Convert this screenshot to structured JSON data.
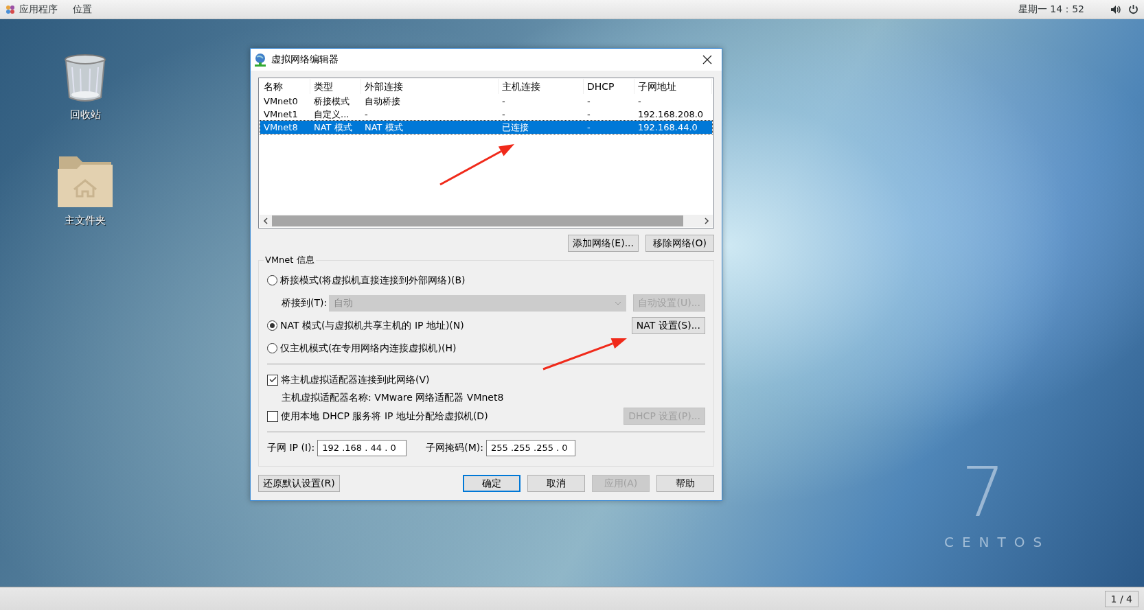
{
  "top_bar": {
    "menus": [
      "应用程序",
      "位置"
    ],
    "clock": "星期一 14：52"
  },
  "desktop_icons": [
    {
      "kind": "trash",
      "label": "回收站"
    },
    {
      "kind": "home",
      "label": "主文件夹"
    }
  ],
  "wallpaper": {
    "logo_number": "7",
    "logo_text": "CENTOS"
  },
  "dialog": {
    "title": "虚拟网络编辑器",
    "table": {
      "columns": [
        "名称",
        "类型",
        "外部连接",
        "主机连接",
        "DHCP",
        "子网地址"
      ],
      "rows": [
        {
          "cells": [
            "VMnet0",
            "桥接模式",
            "自动桥接",
            "-",
            "-",
            "-"
          ],
          "selected": false
        },
        {
          "cells": [
            "VMnet1",
            "自定义...",
            "-",
            "-",
            "-",
            "192.168.208.0"
          ],
          "selected": false
        },
        {
          "cells": [
            "VMnet8",
            "NAT 模式",
            "NAT 模式",
            "已连接",
            "-",
            "192.168.44.0"
          ],
          "selected": true
        }
      ]
    },
    "list_buttons": [
      {
        "label": "添加网络(E)..."
      },
      {
        "label": "移除网络(O)"
      }
    ],
    "vmnet_info": {
      "title": "VMnet 信息",
      "modes": [
        {
          "label": "桥接模式(将虚拟机直接连接到外部网络)(B)",
          "selected": false
        },
        {
          "label": "NAT 模式(与虚拟机共享主机的 IP 地址)(N)",
          "selected": true
        },
        {
          "label": "仅主机模式(在专用网络内连接虚拟机)(H)",
          "selected": false
        }
      ],
      "bridge_to": {
        "label": "桥接到(T):",
        "value": "自动",
        "disabled": true
      },
      "auto_settings_button": {
        "label": "自动设置(U)...",
        "disabled": true
      },
      "nat_settings_button": {
        "label": "NAT 设置(S)...",
        "disabled": false
      },
      "connect_adapter": {
        "label": "将主机虚拟适配器连接到此网络(V)",
        "checked": true
      },
      "adapter_name": "主机虚拟适配器名称: VMware 网络适配器 VMnet8",
      "use_dhcp": {
        "label": "使用本地 DHCP 服务将 IP 地址分配给虚拟机(D)",
        "checked": false
      },
      "dhcp_settings_button": {
        "label": "DHCP 设置(P)...",
        "disabled": true
      },
      "subnet_ip": {
        "label": "子网 IP (I):",
        "value": "192 .168 . 44 . 0"
      },
      "subnet_mask": {
        "label": "子网掩码(M):",
        "value": "255 .255 .255 . 0"
      }
    },
    "reset_button": {
      "label": "还原默认设置(R)",
      "disabled": false
    },
    "buttons": [
      {
        "label": "确定",
        "default": true,
        "disabled": false
      },
      {
        "label": "取消",
        "default": false,
        "disabled": false
      },
      {
        "label": "应用(A)",
        "default": false,
        "disabled": true
      },
      {
        "label": "帮助",
        "default": false,
        "disabled": false
      }
    ]
  },
  "bottom_bar": {
    "workspace": "1 / 4"
  }
}
